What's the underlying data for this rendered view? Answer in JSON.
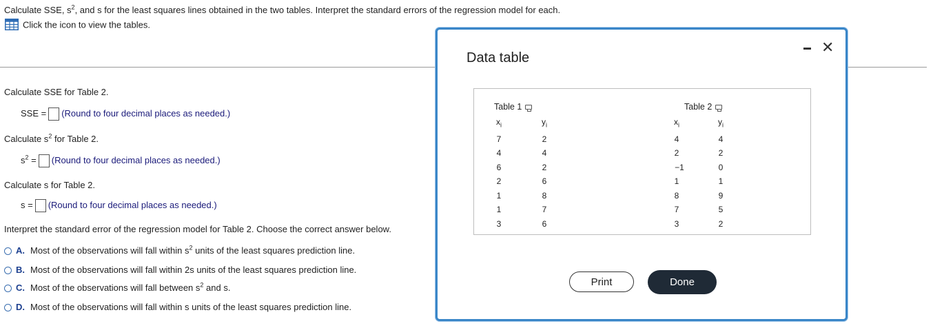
{
  "question": {
    "prompt_a": "Calculate SSE, s",
    "prompt_sup": "2",
    "prompt_b": ", and s for the least squares lines obtained in the two tables. Interpret the standard errors of the regression model for each.",
    "icon_hint": "Click the icon to view the tables."
  },
  "parts": {
    "sse_heading": "Calculate SSE for Table 2.",
    "sse_label": "SSE =",
    "sse_note": "(Round to four decimal places as needed.)",
    "s2_heading_a": "Calculate s",
    "s2_heading_sup": "2",
    "s2_heading_b": " for Table 2.",
    "s2_label_s": "s",
    "s2_label_sup": "2",
    "s2_label_eq": " =",
    "s2_note": "(Round to four decimal places as needed.)",
    "s_heading": "Calculate s for Table 2.",
    "s_label": "s =",
    "s_note": "(Round to four decimal places as needed.)",
    "interpret_heading": "Interpret the standard error of the regression model for Table 2. Choose the correct answer below."
  },
  "options": {
    "a_letter": "A.",
    "a_text_1": "Most of the observations will fall within s",
    "a_sup": "2",
    "a_text_2": " units of the least squares prediction line.",
    "b_letter": "B.",
    "b_text": "Most of the observations will fall within 2s units of the least squares prediction line.",
    "c_letter": "C.",
    "c_text_1": "Most of the observations will fall between s",
    "c_sup": "2",
    "c_text_2": " and s.",
    "d_letter": "D.",
    "d_text": "Most of the observations will fall within s units of the least squares prediction line."
  },
  "modal": {
    "title": "Data table",
    "table1_label": "Table 1",
    "table2_label": "Table 2",
    "x_header": "x",
    "y_header": "y",
    "sub_i": "i",
    "table1": {
      "x": [
        "7",
        "4",
        "6",
        "2",
        "1",
        "1",
        "3"
      ],
      "y": [
        "2",
        "4",
        "2",
        "6",
        "8",
        "7",
        "6"
      ]
    },
    "table2": {
      "x": [
        "4",
        "2",
        "−1",
        "1",
        "8",
        "7",
        "3"
      ],
      "y": [
        "4",
        "2",
        "0",
        "1",
        "9",
        "5",
        "2"
      ]
    },
    "print_label": "Print",
    "done_label": "Done",
    "close_glyph": "✕"
  },
  "colors": {
    "modal_border": "#3a86c8",
    "note_text": "#1a1a7a",
    "radio": "#3b6fb0",
    "done_bg": "#1f2a36"
  },
  "icons": [
    "table-icon",
    "copy-icon",
    "minimize-icon",
    "close-icon",
    "radio-icon"
  ]
}
